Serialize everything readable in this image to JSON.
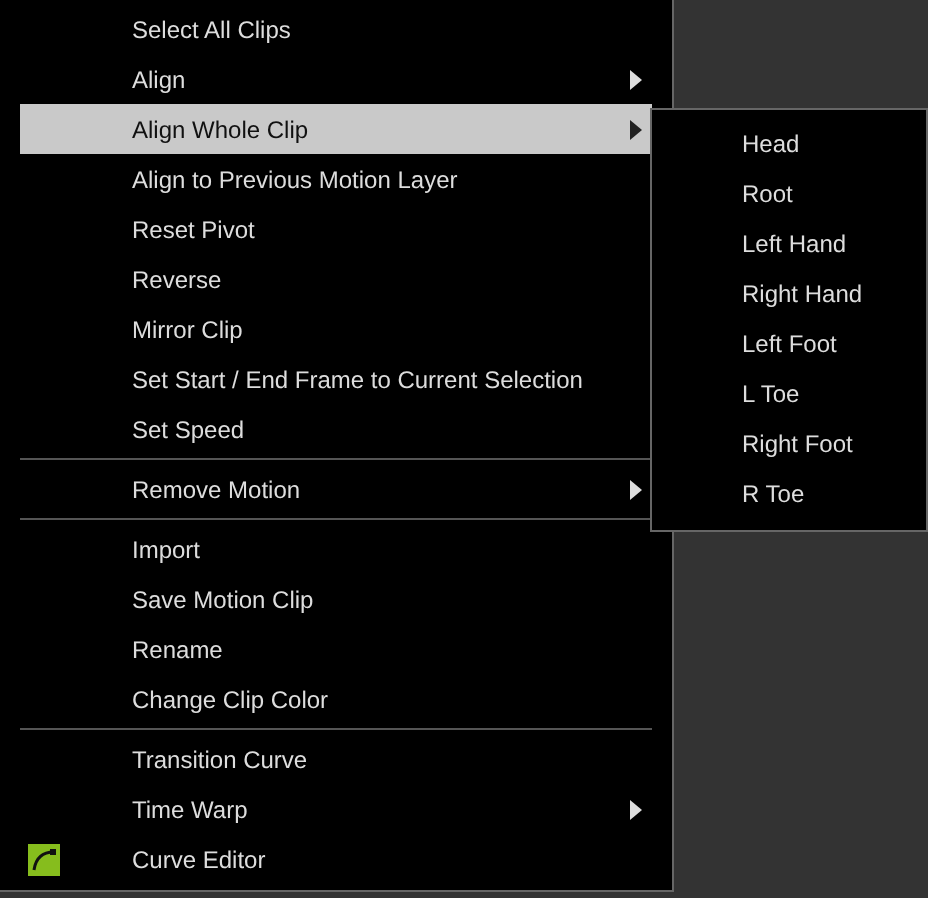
{
  "menu": {
    "sections": [
      {
        "items": [
          {
            "label": "Select All Clips",
            "submenu": false,
            "selected": false,
            "icon": false
          },
          {
            "label": "Align",
            "submenu": true,
            "selected": false,
            "icon": false
          },
          {
            "label": "Align Whole Clip",
            "submenu": true,
            "selected": true,
            "icon": false
          },
          {
            "label": "Align to Previous Motion Layer",
            "submenu": false,
            "selected": false,
            "icon": false
          },
          {
            "label": "Reset Pivot",
            "submenu": false,
            "selected": false,
            "icon": false
          },
          {
            "label": "Reverse",
            "submenu": false,
            "selected": false,
            "icon": false
          },
          {
            "label": "Mirror Clip",
            "submenu": false,
            "selected": false,
            "icon": false
          },
          {
            "label": "Set Start / End Frame to Current Selection",
            "submenu": false,
            "selected": false,
            "icon": false
          },
          {
            "label": "Set Speed",
            "submenu": false,
            "selected": false,
            "icon": false
          }
        ]
      },
      {
        "items": [
          {
            "label": "Remove Motion",
            "submenu": true,
            "selected": false,
            "icon": false
          }
        ]
      },
      {
        "items": [
          {
            "label": "Import",
            "submenu": false,
            "selected": false,
            "icon": false
          },
          {
            "label": "Save Motion Clip",
            "submenu": false,
            "selected": false,
            "icon": false
          },
          {
            "label": "Rename",
            "submenu": false,
            "selected": false,
            "icon": false
          },
          {
            "label": "Change Clip Color",
            "submenu": false,
            "selected": false,
            "icon": false
          }
        ]
      },
      {
        "items": [
          {
            "label": "Transition Curve",
            "submenu": false,
            "selected": false,
            "icon": false
          },
          {
            "label": "Time Warp",
            "submenu": true,
            "selected": false,
            "icon": false
          },
          {
            "label": "Curve Editor",
            "submenu": false,
            "selected": false,
            "icon": true
          }
        ]
      }
    ]
  },
  "submenu": {
    "items": [
      {
        "label": "Head"
      },
      {
        "label": "Root"
      },
      {
        "label": "Left Hand"
      },
      {
        "label": "Right Hand"
      },
      {
        "label": "Left Foot"
      },
      {
        "label": "L Toe"
      },
      {
        "label": "Right Foot"
      },
      {
        "label": "R Toe"
      }
    ]
  }
}
